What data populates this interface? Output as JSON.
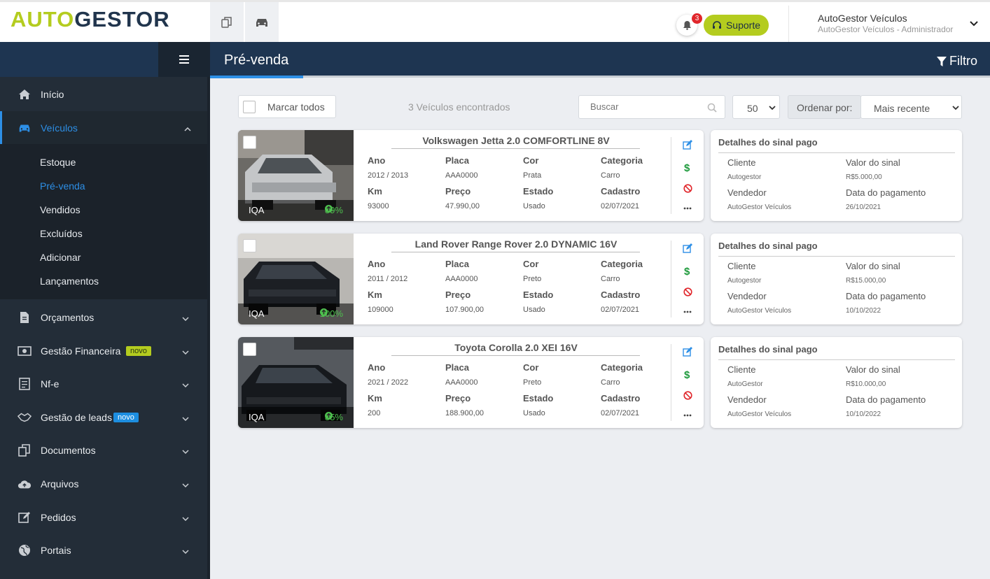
{
  "header": {
    "logo_auto": "AUTO",
    "logo_gestor": "GESTOR",
    "notifications_count": "3",
    "support_label": "Suporte",
    "user_name": "AutoGestor Veículos",
    "user_role": "AutoGestor Veículos - Administrador"
  },
  "sidebar": {
    "items": [
      {
        "label": "Início",
        "icon": "home-icon"
      },
      {
        "label": "Veículos",
        "icon": "car-icon"
      },
      {
        "label": "Orçamentos",
        "icon": "document-icon"
      },
      {
        "label": "Gestão Financeira",
        "icon": "money-icon",
        "badge": "novo"
      },
      {
        "label": "Nf-e",
        "icon": "invoice-icon"
      },
      {
        "label": "Gestão de leads",
        "icon": "handshake-icon",
        "badge": "novo"
      },
      {
        "label": "Documentos",
        "icon": "files-icon"
      },
      {
        "label": "Arquivos",
        "icon": "cloud-upload-icon"
      },
      {
        "label": "Pedidos",
        "icon": "edit-icon"
      },
      {
        "label": "Portais",
        "icon": "globe-icon"
      }
    ],
    "vehicles_submenu": [
      "Estoque",
      "Pré-venda",
      "Vendidos",
      "Excluídos",
      "Adicionar",
      "Lançamentos"
    ]
  },
  "main": {
    "page_title": "Pré-venda",
    "filter_label": "Filtro",
    "select_all_label": "Marcar todos",
    "found_text": "3 Veículos encontrados",
    "search_placeholder": "Buscar",
    "per_page": "50",
    "order_label": "Ordenar por:",
    "order_value": "Mais recente",
    "field_labels": {
      "year": "Ano",
      "plate": "Placa",
      "color": "Cor",
      "category": "Categoria",
      "km": "Km",
      "price": "Preço",
      "condition": "Estado",
      "registered": "Cadastro"
    },
    "detail_labels": {
      "title": "Detalhes do sinal pago",
      "client": "Cliente",
      "deposit_value": "Valor do sinal",
      "seller": "Vendedor",
      "payment_date": "Data do pagamento"
    },
    "iqa_label": "IQA",
    "vehicles": [
      {
        "title": "Volkswagen Jetta 2.0 COMFORTLINE 8V",
        "year": "2012 / 2013",
        "plate": "AAA0000",
        "color": "Prata",
        "category": "Carro",
        "km": "93000",
        "price": "47.990,00",
        "condition": "Usado",
        "registered": "02/07/2021",
        "iqa": "89%",
        "client": "Autogestor",
        "deposit": "R$5.000,00",
        "seller": "AutoGestor Veículos",
        "pay_date": "26/10/2021"
      },
      {
        "title": "Land Rover Range Rover 2.0 DYNAMIC 16V",
        "year": "2011 / 2012",
        "plate": "AAA0000",
        "color": "Preto",
        "category": "Carro",
        "km": "109000",
        "price": "107.900,00",
        "condition": "Usado",
        "registered": "02/07/2021",
        "iqa": "100%",
        "client": "Autogestor",
        "deposit": "R$15.000,00",
        "seller": "AutoGestor Veículos",
        "pay_date": "10/10/2022"
      },
      {
        "title": "Toyota Corolla 2.0 XEI 16V",
        "year": "2021 / 2022",
        "plate": "AAA0000",
        "color": "Preto",
        "category": "Carro",
        "km": "200",
        "price": "188.900,00",
        "condition": "Usado",
        "registered": "02/07/2021",
        "iqa": "85%",
        "client": "AutoGestor",
        "deposit": "R$10.000,00",
        "seller": "AutoGestor Veículos",
        "pay_date": "10/10/2022"
      }
    ]
  },
  "colors": {
    "brand_green": "#b4cc1f",
    "brand_navy": "#1e3551",
    "accent_blue": "#2d8fe6",
    "sidebar_bg": "#232d38"
  }
}
